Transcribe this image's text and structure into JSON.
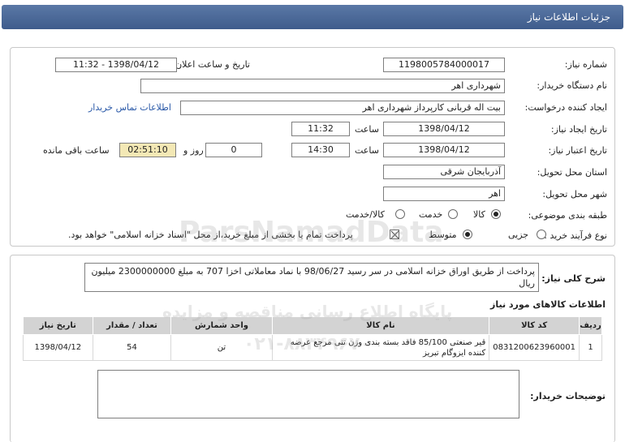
{
  "header": {
    "title": "جزئیات اطلاعات نیاز"
  },
  "form": {
    "need_number_label": "شماره نیاز:",
    "need_number": "1198005784000017",
    "announce_label": "تاریخ و ساعت اعلان عمومی:",
    "announce_value": "1398/04/12 - 11:32",
    "buyer_label": "نام دستگاه خریدار:",
    "buyer_value": "شهرداری اهر",
    "creator_label": "ایجاد کننده درخواست:",
    "creator_value": "بیت اله قربانی کارپرداز شهرداری اهر",
    "contact_link": "اطلاعات تماس خریدار",
    "created_date_label": "تاریخ ایجاد نیاز:",
    "created_date": "1398/04/12",
    "time_label": "ساعت",
    "created_time": "11:32",
    "valid_date_label": "تاریخ اعتبار نیاز:",
    "valid_date": "1398/04/12",
    "valid_time": "14:30",
    "days_value": "0",
    "day_and_label": "روز و",
    "remaining_time": "02:51:10",
    "remaining_label": "ساعت باقی مانده",
    "province_label": "استان محل تحویل:",
    "province_value": "آذربایجان شرقی",
    "city_label": "شهر محل تحویل:",
    "city_value": "اهر",
    "category_label": "طبقه بندی موضوعی:",
    "category_options": [
      "کالا",
      "خدمت",
      "کالا/خدمت"
    ],
    "process_label": "نوع فرآیند خرید :",
    "process_options": [
      "جزیی",
      "متوسط"
    ],
    "payment_note": "پرداخت تمام یا بخشی از مبلغ خرید،از محل \"اسناد خزانه اسلامی\" خواهد بود."
  },
  "general_desc": {
    "label": "شرح کلی نیاز:",
    "text": "پرداخت از طریق اوراق خزانه اسلامی در سر رسید 98/06/27 با نماد معاملاتی اخزا 707 به مبلغ 2300000000 میلیون ریال"
  },
  "goods": {
    "title": "اطلاعات کالاهای مورد نیاز",
    "headers": [
      "ردیف",
      "کد کالا",
      "نام کالا",
      "واحد شمارش",
      "تعداد / مقدار",
      "تاریخ نیاز"
    ],
    "rows": [
      [
        "1",
        "0831200623960001",
        "قیر صنعتی 85/100 فاقد بسته بندی وزن تنی مرجع عرضه کننده ایزوگام تبریز",
        "تن",
        "54",
        "1398/04/12"
      ]
    ]
  },
  "buyer_notes": {
    "label": "توضیحات خریدار:"
  },
  "watermarks": {
    "line1": "ParsNamadData",
    "line2": "پایگاه اطلاع رسانی مناقصه و مزایده",
    "line3": "۰۲۱-۸۸۳۴۹۶۷۰"
  }
}
